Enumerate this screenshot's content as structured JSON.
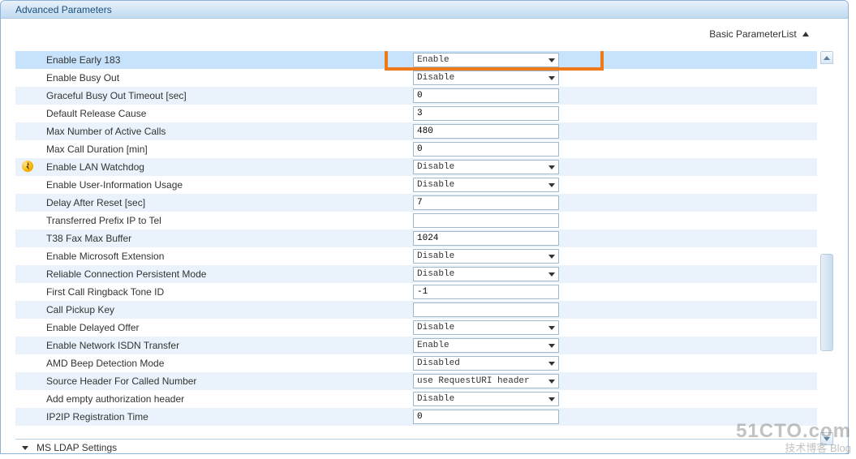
{
  "panel": {
    "title": "Advanced Parameters"
  },
  "topLink": {
    "label": "Basic ParameterList"
  },
  "highlightIndex": 0,
  "rows": [
    {
      "label": "Enable Early 183",
      "type": "select",
      "value": "Enable",
      "icon": null
    },
    {
      "label": "Enable Busy Out",
      "type": "select",
      "value": "Disable",
      "icon": null
    },
    {
      "label": "Graceful Busy Out Timeout [sec]",
      "type": "text",
      "value": "0",
      "icon": null
    },
    {
      "label": "Default Release Cause",
      "type": "text",
      "value": "3",
      "icon": null
    },
    {
      "label": "Max Number of Active Calls",
      "type": "text",
      "value": "480",
      "icon": null
    },
    {
      "label": "Max Call Duration [min]",
      "type": "text",
      "value": "0",
      "icon": null
    },
    {
      "label": "Enable LAN Watchdog",
      "type": "select",
      "value": "Disable",
      "icon": "lightning"
    },
    {
      "label": "Enable User-Information Usage",
      "type": "select",
      "value": "Disable",
      "icon": null
    },
    {
      "label": "Delay After Reset [sec]",
      "type": "text",
      "value": "7",
      "icon": null
    },
    {
      "label": "Transferred Prefix IP to Tel",
      "type": "text",
      "value": "",
      "icon": null
    },
    {
      "label": "T38 Fax Max Buffer",
      "type": "text",
      "value": "1024",
      "icon": null
    },
    {
      "label": "Enable Microsoft Extension",
      "type": "select",
      "value": "Disable",
      "icon": null
    },
    {
      "label": "Reliable Connection Persistent Mode",
      "type": "select",
      "value": "Disable",
      "icon": null
    },
    {
      "label": "First Call Ringback Tone ID",
      "type": "text",
      "value": "-1",
      "icon": null
    },
    {
      "label": "Call Pickup Key",
      "type": "text",
      "value": "",
      "icon": null
    },
    {
      "label": "Enable Delayed Offer",
      "type": "select",
      "value": "Disable",
      "icon": null
    },
    {
      "label": "Enable Network ISDN Transfer",
      "type": "select",
      "value": "Enable",
      "icon": null
    },
    {
      "label": "AMD Beep Detection Mode",
      "type": "select",
      "value": "Disabled",
      "icon": null
    },
    {
      "label": "Source Header For Called Number",
      "type": "select",
      "value": "use RequestURI header",
      "icon": null
    },
    {
      "label": "Add empty authorization header",
      "type": "select",
      "value": "Disable",
      "icon": null
    },
    {
      "label": "IP2IP Registration Time",
      "type": "text",
      "value": "0",
      "icon": null
    }
  ],
  "sectionHeader": {
    "label": "MS LDAP Settings"
  },
  "watermark": {
    "line1": "51CTO.com",
    "line2": "技术博客   Blog"
  }
}
